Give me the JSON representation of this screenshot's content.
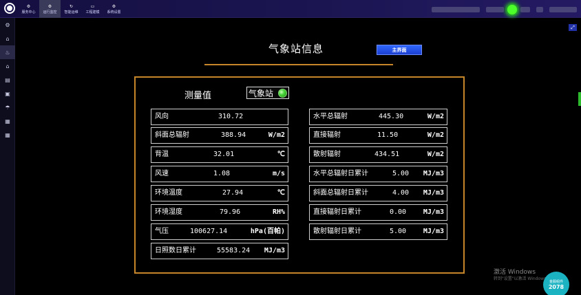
{
  "nav": [
    {
      "icon": "⚙",
      "label": "服务中心"
    },
    {
      "icon": "⚙",
      "label": "运行监控"
    },
    {
      "icon": "↻",
      "label": "智能运维"
    },
    {
      "icon": "▭",
      "label": "工程建模"
    },
    {
      "icon": "⚙",
      "label": "系统设置"
    }
  ],
  "sidebar_icons": [
    "⚙",
    "⌂",
    "♨",
    "⌂",
    "▤",
    "▣",
    "☂",
    "▦",
    "▦"
  ],
  "page_title": "气象站信息",
  "home_button": "主界面",
  "heading": "测量值",
  "station_label": "气象站",
  "left_rows": [
    {
      "label": "风向",
      "value": "310.72",
      "unit": ""
    },
    {
      "label": "斜面总辐射",
      "value": "388.94",
      "unit": "W/m2"
    },
    {
      "label": "背温",
      "value": "32.01",
      "unit": "℃"
    },
    {
      "label": "风速",
      "value": "1.08",
      "unit": "m/s"
    },
    {
      "label": "环境温度",
      "value": "27.94",
      "unit": "℃"
    },
    {
      "label": "环境湿度",
      "value": "79.96",
      "unit": "RH%"
    },
    {
      "label": "气压",
      "value": "100627.14",
      "unit": "hPa(百帕)"
    },
    {
      "label": "日照数日累计",
      "value": "55583.24",
      "unit": "MJ/m3"
    }
  ],
  "right_rows": [
    {
      "label": "水平总辐射",
      "value": "445.30",
      "unit": "W/m2"
    },
    {
      "label": "直接辐射",
      "value": "11.50",
      "unit": "W/m2"
    },
    {
      "label": "散射辐射",
      "value": "434.51",
      "unit": "W/m2"
    },
    {
      "label": "水平总辐射日累计",
      "value": "5.00",
      "unit": "MJ/m3"
    },
    {
      "label": "斜面总辐射日累计",
      "value": "4.00",
      "unit": "MJ/m3"
    },
    {
      "label": "直接辐射日累计",
      "value": "0.00",
      "unit": "MJ/m3"
    },
    {
      "label": "散射辐射日累计",
      "value": "5.00",
      "unit": "MJ/m3"
    }
  ],
  "watermark": "激活 Windows",
  "watermark_sub": "转到\"设置\"以激活 Windows",
  "badge_title": "金服组件",
  "badge_number": "2078",
  "colors": {
    "accent": "#c8862a",
    "button": "#2f66ff",
    "status_ok": "#48d43a"
  }
}
